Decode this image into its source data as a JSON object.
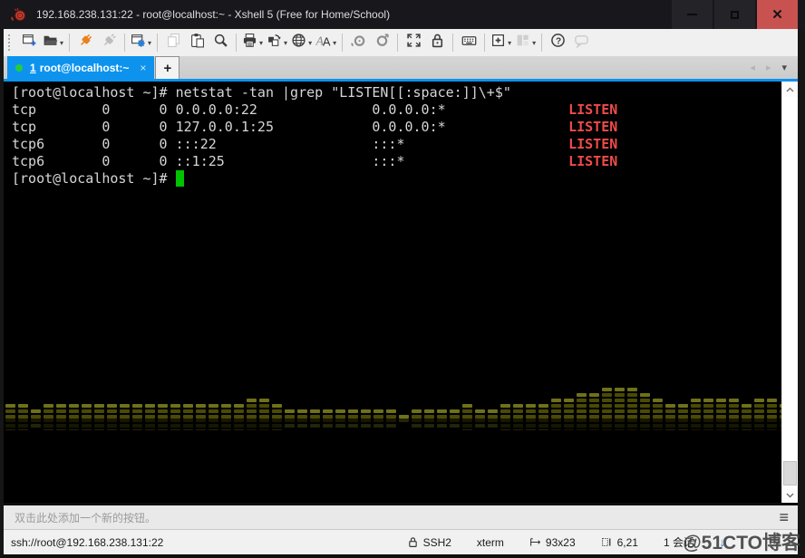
{
  "window": {
    "title": "192.168.238.131:22 - root@localhost:~ - Xshell 5 (Free for Home/School)"
  },
  "colors": {
    "accent_blue": "#0d93ee",
    "connected_green": "#24cc3d",
    "cursor_green": "#00c300",
    "listen_red": "#ef4b4b",
    "close_red": "#c85250",
    "spectrum_bar": "#4a4a06",
    "spectrum_bar_bright": "#70701a"
  },
  "toolbar": {
    "dropdown_glyph": "▾",
    "groups": [
      {
        "items": [
          {
            "name": "new-session"
          },
          {
            "name": "open-session",
            "dropdown": true
          }
        ]
      },
      {
        "items": [
          {
            "name": "reconnect"
          },
          {
            "name": "disconnect",
            "disabled": true
          }
        ]
      },
      {
        "items": [
          {
            "name": "session-properties",
            "dropdown": true
          }
        ]
      },
      {
        "items": [
          {
            "name": "copy",
            "disabled": true
          },
          {
            "name": "paste"
          },
          {
            "name": "find"
          }
        ]
      },
      {
        "items": [
          {
            "name": "print",
            "dropdown": true
          },
          {
            "name": "color-scheme",
            "dropdown": true
          },
          {
            "name": "web-browser",
            "dropdown": true
          },
          {
            "name": "font",
            "dropdown": true
          }
        ]
      },
      {
        "items": [
          {
            "name": "xshell"
          },
          {
            "name": "xftp"
          }
        ]
      },
      {
        "items": [
          {
            "name": "full-screen"
          },
          {
            "name": "lock-screen"
          }
        ]
      },
      {
        "items": [
          {
            "name": "virtual-keyboard"
          }
        ]
      },
      {
        "items": [
          {
            "name": "new-terminal",
            "dropdown": true
          },
          {
            "name": "tile-windows",
            "disabled": true,
            "dropdown": true
          }
        ]
      },
      {
        "items": [
          {
            "name": "help"
          },
          {
            "name": "feedback",
            "disabled": true
          }
        ]
      }
    ]
  },
  "tab_bar": {
    "active_tab": {
      "index_label": "1",
      "label": "root@localhost:~",
      "close_glyph": "×"
    },
    "new_tab_glyph": "+",
    "nav": {
      "prev_glyph": "◂",
      "next_glyph": "▸",
      "menu_glyph": "▾"
    }
  },
  "terminal": {
    "lines": [
      {
        "segments": [
          {
            "text": "[root@localhost ~]# netstat -tan |grep \"LISTEN[[:space:]]\\+$\""
          }
        ]
      },
      {
        "segments": [
          {
            "text": "tcp        0      0 0.0.0.0:22              0.0.0.0:*               "
          },
          {
            "text": "LISTEN",
            "color": "red"
          }
        ]
      },
      {
        "segments": [
          {
            "text": "tcp        0      0 127.0.0.1:25            0.0.0.0:*               "
          },
          {
            "text": "LISTEN",
            "color": "red"
          }
        ]
      },
      {
        "segments": [
          {
            "text": "tcp6       0      0 :::22                   :::*                    "
          },
          {
            "text": "LISTEN",
            "color": "red"
          }
        ]
      },
      {
        "segments": [
          {
            "text": "tcp6       0      0 ::1:25                  :::*                    "
          },
          {
            "text": "LISTEN",
            "color": "red"
          }
        ]
      },
      {
        "segments": [
          {
            "text": "[root@localhost ~]# "
          },
          {
            "text": " ",
            "cursor": true
          }
        ]
      }
    ]
  },
  "spectrum": {
    "bar_heights": [
      3,
      3,
      2,
      3,
      3,
      3,
      3,
      3,
      3,
      3,
      3,
      3,
      3,
      3,
      3,
      3,
      3,
      3,
      3,
      4,
      4,
      3,
      2,
      2,
      2,
      2,
      2,
      2,
      2,
      2,
      2,
      1,
      2,
      2,
      2,
      2,
      3,
      2,
      2,
      3,
      3,
      3,
      3,
      4,
      4,
      5,
      5,
      6,
      6,
      6,
      5,
      4,
      3,
      3,
      4,
      4,
      4,
      4,
      3,
      4,
      4,
      3,
      2
    ]
  },
  "quick_button_bar": {
    "hint": "双击此处添加一个新的按钮。",
    "menu_glyph": "≡"
  },
  "status_bar": {
    "connection_url": "ssh://root@192.168.238.131:22",
    "protocol": "SSH2",
    "terminal_type": "xterm",
    "terminal_size": "93x23",
    "cursor_position": "6,21",
    "session_count": "1 会话",
    "scroll_up_glyph": "↑",
    "scroll_down_glyph": "↓"
  },
  "watermark": {
    "text": "@51CTO博客"
  }
}
